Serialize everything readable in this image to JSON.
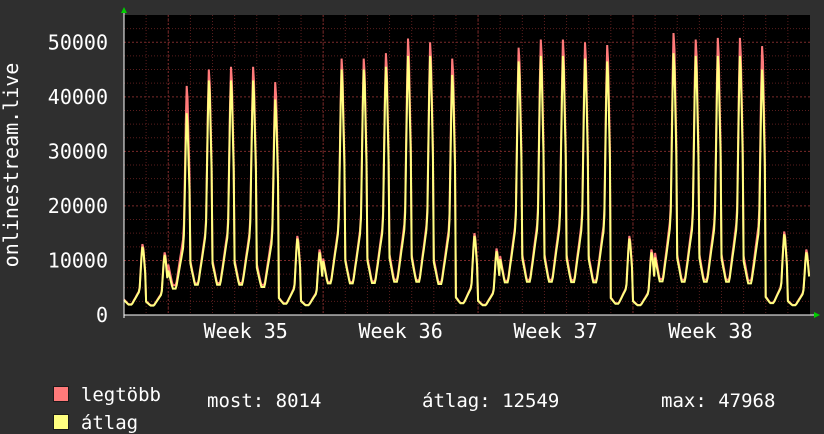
{
  "chart_data": {
    "type": "line",
    "ylabel": "onlinestream.live",
    "ylim": [
      0,
      55000
    ],
    "yticks": [
      0,
      10000,
      20000,
      30000,
      40000,
      50000
    ],
    "xticks": [
      "Week 35",
      "Week 36",
      "Week 37",
      "Week 38"
    ],
    "grid": true,
    "series": [
      {
        "name": "legtöbb",
        "color": "#ff7a7a",
        "daily_peaks": [
          13000,
          11500,
          42000,
          45000,
          45500,
          45500,
          42700,
          14500,
          12000,
          47000,
          47000,
          48000,
          50700,
          50000,
          47000,
          15000,
          12200,
          49000,
          50500,
          50500,
          50000,
          49500,
          14500,
          12000,
          51700,
          50500,
          50800,
          50800,
          49300,
          15300,
          12000
        ]
      },
      {
        "name": "átlag",
        "color": "#ffff80",
        "daily_peaks": [
          12500,
          11000,
          37000,
          43000,
          43000,
          43000,
          39500,
          14000,
          11500,
          45000,
          45000,
          45500,
          47500,
          47500,
          44000,
          14500,
          11700,
          46500,
          47500,
          47500,
          47000,
          46500,
          14000,
          11500,
          48000,
          47500,
          47500,
          47500,
          45000,
          14800,
          11500
        ]
      }
    ]
  },
  "legend": {
    "max_label": "legtöbb",
    "avg_label": "átlag"
  },
  "stats": {
    "most": "most: 8014",
    "atlag": "átlag: 12549",
    "max": "max: 47968"
  },
  "colors": {
    "background": "#2f2f2f",
    "plot_background": "#000000",
    "grid_minor": "#5a1e1e",
    "grid_major": "#7a2a2a",
    "axis_arrow": "#00cc00"
  }
}
